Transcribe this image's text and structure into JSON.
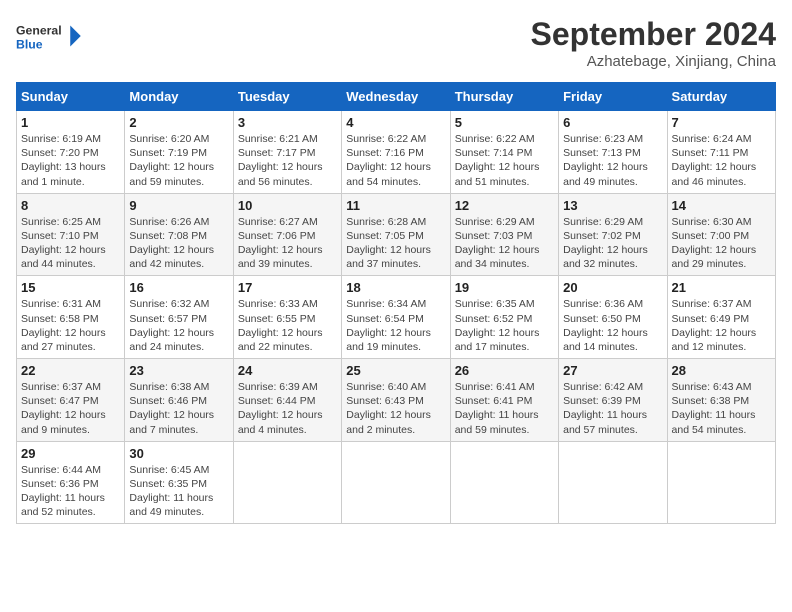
{
  "logo": {
    "line1": "General",
    "line2": "Blue"
  },
  "title": "September 2024",
  "subtitle": "Azhatebage, Xinjiang, China",
  "days_of_week": [
    "Sunday",
    "Monday",
    "Tuesday",
    "Wednesday",
    "Thursday",
    "Friday",
    "Saturday"
  ],
  "weeks": [
    [
      {
        "day": 1,
        "info": "Sunrise: 6:19 AM\nSunset: 7:20 PM\nDaylight: 13 hours and 1 minute."
      },
      {
        "day": 2,
        "info": "Sunrise: 6:20 AM\nSunset: 7:19 PM\nDaylight: 12 hours and 59 minutes."
      },
      {
        "day": 3,
        "info": "Sunrise: 6:21 AM\nSunset: 7:17 PM\nDaylight: 12 hours and 56 minutes."
      },
      {
        "day": 4,
        "info": "Sunrise: 6:22 AM\nSunset: 7:16 PM\nDaylight: 12 hours and 54 minutes."
      },
      {
        "day": 5,
        "info": "Sunrise: 6:22 AM\nSunset: 7:14 PM\nDaylight: 12 hours and 51 minutes."
      },
      {
        "day": 6,
        "info": "Sunrise: 6:23 AM\nSunset: 7:13 PM\nDaylight: 12 hours and 49 minutes."
      },
      {
        "day": 7,
        "info": "Sunrise: 6:24 AM\nSunset: 7:11 PM\nDaylight: 12 hours and 46 minutes."
      }
    ],
    [
      {
        "day": 8,
        "info": "Sunrise: 6:25 AM\nSunset: 7:10 PM\nDaylight: 12 hours and 44 minutes."
      },
      {
        "day": 9,
        "info": "Sunrise: 6:26 AM\nSunset: 7:08 PM\nDaylight: 12 hours and 42 minutes."
      },
      {
        "day": 10,
        "info": "Sunrise: 6:27 AM\nSunset: 7:06 PM\nDaylight: 12 hours and 39 minutes."
      },
      {
        "day": 11,
        "info": "Sunrise: 6:28 AM\nSunset: 7:05 PM\nDaylight: 12 hours and 37 minutes."
      },
      {
        "day": 12,
        "info": "Sunrise: 6:29 AM\nSunset: 7:03 PM\nDaylight: 12 hours and 34 minutes."
      },
      {
        "day": 13,
        "info": "Sunrise: 6:29 AM\nSunset: 7:02 PM\nDaylight: 12 hours and 32 minutes."
      },
      {
        "day": 14,
        "info": "Sunrise: 6:30 AM\nSunset: 7:00 PM\nDaylight: 12 hours and 29 minutes."
      }
    ],
    [
      {
        "day": 15,
        "info": "Sunrise: 6:31 AM\nSunset: 6:58 PM\nDaylight: 12 hours and 27 minutes."
      },
      {
        "day": 16,
        "info": "Sunrise: 6:32 AM\nSunset: 6:57 PM\nDaylight: 12 hours and 24 minutes."
      },
      {
        "day": 17,
        "info": "Sunrise: 6:33 AM\nSunset: 6:55 PM\nDaylight: 12 hours and 22 minutes."
      },
      {
        "day": 18,
        "info": "Sunrise: 6:34 AM\nSunset: 6:54 PM\nDaylight: 12 hours and 19 minutes."
      },
      {
        "day": 19,
        "info": "Sunrise: 6:35 AM\nSunset: 6:52 PM\nDaylight: 12 hours and 17 minutes."
      },
      {
        "day": 20,
        "info": "Sunrise: 6:36 AM\nSunset: 6:50 PM\nDaylight: 12 hours and 14 minutes."
      },
      {
        "day": 21,
        "info": "Sunrise: 6:37 AM\nSunset: 6:49 PM\nDaylight: 12 hours and 12 minutes."
      }
    ],
    [
      {
        "day": 22,
        "info": "Sunrise: 6:37 AM\nSunset: 6:47 PM\nDaylight: 12 hours and 9 minutes."
      },
      {
        "day": 23,
        "info": "Sunrise: 6:38 AM\nSunset: 6:46 PM\nDaylight: 12 hours and 7 minutes."
      },
      {
        "day": 24,
        "info": "Sunrise: 6:39 AM\nSunset: 6:44 PM\nDaylight: 12 hours and 4 minutes."
      },
      {
        "day": 25,
        "info": "Sunrise: 6:40 AM\nSunset: 6:43 PM\nDaylight: 12 hours and 2 minutes."
      },
      {
        "day": 26,
        "info": "Sunrise: 6:41 AM\nSunset: 6:41 PM\nDaylight: 11 hours and 59 minutes."
      },
      {
        "day": 27,
        "info": "Sunrise: 6:42 AM\nSunset: 6:39 PM\nDaylight: 11 hours and 57 minutes."
      },
      {
        "day": 28,
        "info": "Sunrise: 6:43 AM\nSunset: 6:38 PM\nDaylight: 11 hours and 54 minutes."
      }
    ],
    [
      {
        "day": 29,
        "info": "Sunrise: 6:44 AM\nSunset: 6:36 PM\nDaylight: 11 hours and 52 minutes."
      },
      {
        "day": 30,
        "info": "Sunrise: 6:45 AM\nSunset: 6:35 PM\nDaylight: 11 hours and 49 minutes."
      },
      null,
      null,
      null,
      null,
      null
    ]
  ]
}
